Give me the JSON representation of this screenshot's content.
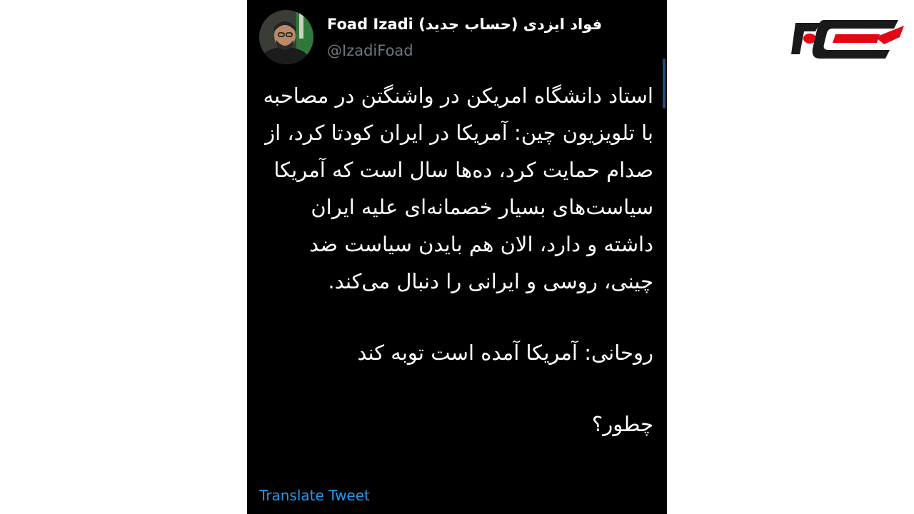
{
  "tweet": {
    "display_name": "Foad Izadi فواد ایزدی (حساب جدید)",
    "handle": "@IzadiFoad",
    "paragraphs": [
      "استاد دانشگاه امریکن در واشنگتن در مصاحبه با تلویزیون چین: آمریکا در ایران کودتا کرد، از صدام حمایت کرد، ده‌ها سال است که آمریکا سیاست‌های بسیار خصمانه‌ای علیه ایران داشته و دارد، الان هم بایدن سیاست ضد چینی، روسی و ایرانی را دنبال می‌کند.",
      "روحانی: آمریکا آمده است توبه کند",
      "چطور؟"
    ],
    "translate_label": "Translate Tweet"
  },
  "icons": {
    "avatar": "avatar-photo",
    "brand": "rokna-logo"
  },
  "colors": {
    "card_background": "#000000",
    "page_background": "#ffffff",
    "text": "#ffffff",
    "handle": "#6e767d",
    "link": "#1d9bf0",
    "brand_red": "#e30613",
    "brand_dark": "#1a1a1a"
  }
}
